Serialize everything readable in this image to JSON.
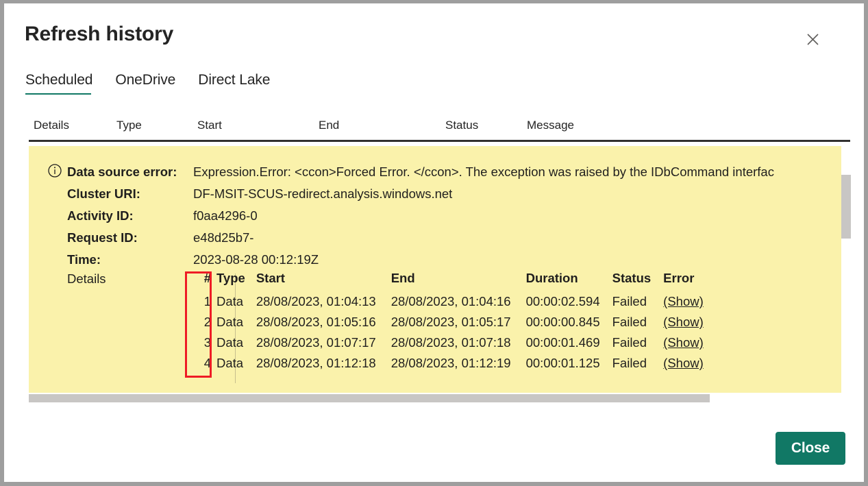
{
  "dialog": {
    "title": "Refresh history",
    "close_icon": "close-icon",
    "close_button_label": "Close",
    "accent_color": "#117865",
    "panel_color": "#faf2ab",
    "highlight_color": "#ee1c25"
  },
  "tabs": [
    {
      "label": "Scheduled",
      "active": true
    },
    {
      "label": "OneDrive",
      "active": false
    },
    {
      "label": "Direct Lake",
      "active": false
    }
  ],
  "columns": [
    {
      "label": "Details"
    },
    {
      "label": "Type"
    },
    {
      "label": "Start"
    },
    {
      "label": "End"
    },
    {
      "label": "Status"
    },
    {
      "label": "Message"
    }
  ],
  "error_panel": {
    "info_icon": "info-circle-icon",
    "fields": [
      {
        "label": "Data source error:",
        "value": "Expression.Error: <ccon>Forced Error. </ccon>. The exception was raised by the IDbCommand interfac"
      },
      {
        "label": "Cluster URI:",
        "value": "DF-MSIT-SCUS-redirect.analysis.windows.net"
      },
      {
        "label": "Activity ID:",
        "value": "f0aa4296-0"
      },
      {
        "label": "Request ID:",
        "value": "e48d25b7-"
      },
      {
        "label": "Time:",
        "value": "2023-08-28 00:12:19Z"
      }
    ],
    "details_label": "Details",
    "details_table": {
      "headers": [
        "#",
        "Type",
        "Start",
        "End",
        "Duration",
        "Status",
        "Error"
      ],
      "rows": [
        {
          "num": "1",
          "type": "Data",
          "start": "28/08/2023, 01:04:13",
          "end": "28/08/2023, 01:04:16",
          "duration": "00:00:02.594",
          "status": "Failed",
          "error": "(Show)"
        },
        {
          "num": "2",
          "type": "Data",
          "start": "28/08/2023, 01:05:16",
          "end": "28/08/2023, 01:05:17",
          "duration": "00:00:00.845",
          "status": "Failed",
          "error": "(Show)"
        },
        {
          "num": "3",
          "type": "Data",
          "start": "28/08/2023, 01:07:17",
          "end": "28/08/2023, 01:07:18",
          "duration": "00:00:01.469",
          "status": "Failed",
          "error": "(Show)"
        },
        {
          "num": "4",
          "type": "Data",
          "start": "28/08/2023, 01:12:18",
          "end": "28/08/2023, 01:12:19",
          "duration": "00:00:01.125",
          "status": "Failed",
          "error": "(Show)"
        }
      ]
    }
  }
}
